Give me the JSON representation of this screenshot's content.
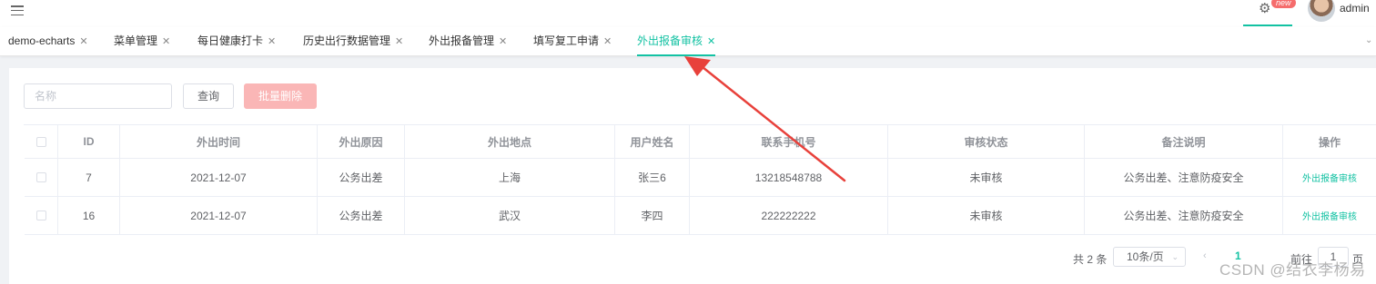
{
  "header": {
    "menu_icon": "hamburger-icon",
    "settings_icon": "gear-icon",
    "badge": "new",
    "user_name": "admin"
  },
  "tabs": [
    {
      "label": "demo-echarts",
      "active": false
    },
    {
      "label": "菜单管理",
      "active": false
    },
    {
      "label": "每日健康打卡",
      "active": false
    },
    {
      "label": "历史出行数据管理",
      "active": false
    },
    {
      "label": "外出报备管理",
      "active": false
    },
    {
      "label": "填写复工申请",
      "active": false
    },
    {
      "label": "外出报备审核",
      "active": true
    }
  ],
  "toolbar": {
    "search_placeholder": "名称",
    "search_value": "",
    "query_label": "查询",
    "batch_delete_label": "批量删除"
  },
  "table": {
    "columns": [
      "",
      "ID",
      "外出时间",
      "外出原因",
      "外出地点",
      "用户姓名",
      "联系手机号",
      "审核状态",
      "备注说明",
      "操作"
    ],
    "rows": [
      {
        "id": "7",
        "time": "2021-12-07",
        "reason": "公务出差",
        "place": "上海",
        "user": "张三6",
        "phone": "13218548788",
        "status": "未审核",
        "remark": "公务出差、注意防疫安全",
        "action": "外出报备审核"
      },
      {
        "id": "16",
        "time": "2021-12-07",
        "reason": "公务出差",
        "place": "武汉",
        "user": "李四",
        "phone": "222222222",
        "status": "未审核",
        "remark": "公务出差、注意防疫安全",
        "action": "外出报备审核"
      }
    ]
  },
  "pagination": {
    "total_label": "共 2 条",
    "page_size": "10条/页",
    "current_page": "1",
    "goto_label": "前往",
    "goto_value": "1",
    "goto_suffix": "页"
  },
  "watermark": "CSDN @结衣李杨易",
  "colors": {
    "accent": "#13c2a3",
    "danger_light": "#fab6b6",
    "annotation_arrow": "#e8413b"
  }
}
